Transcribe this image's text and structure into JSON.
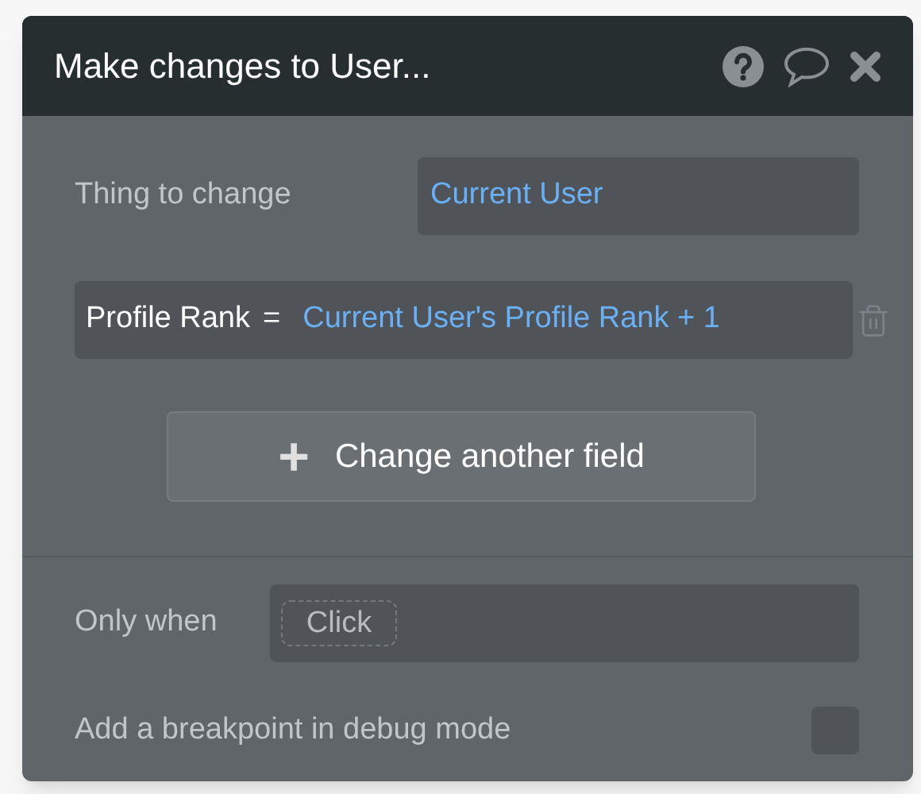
{
  "dialog": {
    "title": "Make changes to User..."
  },
  "thing_to_change": {
    "label": "Thing to change",
    "value": "Current User"
  },
  "fields": [
    {
      "name": "Profile Rank",
      "operator": "=",
      "value": "Current User's Profile Rank + 1"
    }
  ],
  "add_button": {
    "icon": "+",
    "label": "Change another field"
  },
  "only_when": {
    "label": "Only when",
    "placeholder": "Click"
  },
  "breakpoint": {
    "label": "Add a breakpoint in debug mode",
    "checked": false
  }
}
